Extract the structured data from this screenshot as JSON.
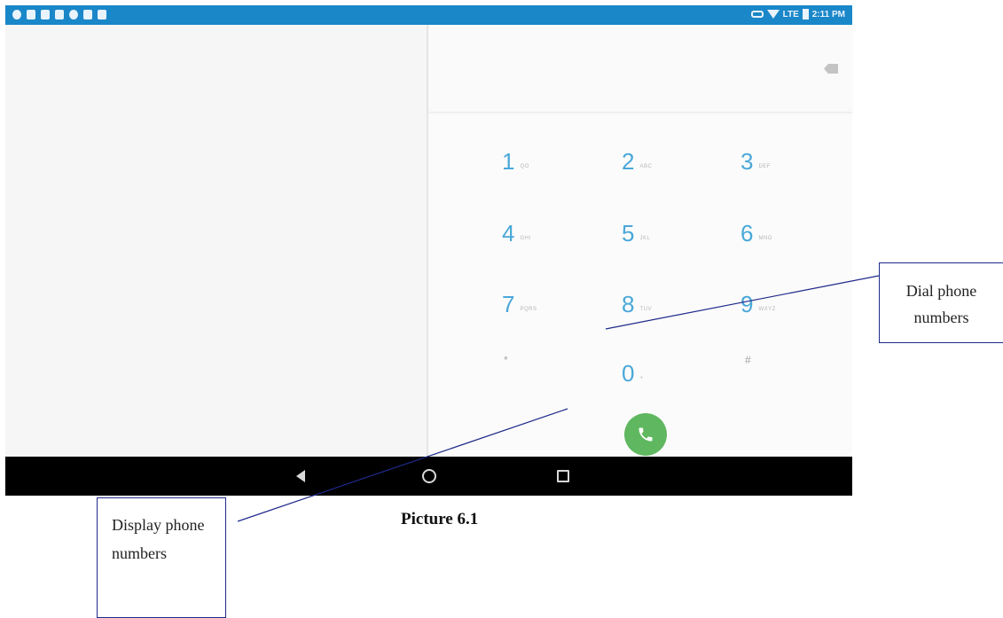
{
  "status_bar": {
    "network": "LTE",
    "time": "2:11 PM",
    "left_icons": [
      "notification-icon",
      "notification-icon",
      "notification-icon",
      "notification-icon",
      "notification-icon",
      "notification-icon",
      "notification-icon"
    ]
  },
  "dialpad": {
    "keys": [
      {
        "digit": "1",
        "letters": "QO"
      },
      {
        "digit": "2",
        "letters": "ABC"
      },
      {
        "digit": "3",
        "letters": "DEF"
      },
      {
        "digit": "4",
        "letters": "GHI"
      },
      {
        "digit": "5",
        "letters": "JKL"
      },
      {
        "digit": "6",
        "letters": "MNO"
      },
      {
        "digit": "7",
        "letters": "PQRS"
      },
      {
        "digit": "8",
        "letters": "TUV"
      },
      {
        "digit": "9",
        "letters": "WXYZ"
      },
      {
        "digit": "*",
        "letters": ""
      },
      {
        "digit": "0",
        "letters": "+"
      },
      {
        "digit": "#",
        "letters": ""
      }
    ]
  },
  "annotations": {
    "dial_label": "Dial phone numbers",
    "display_label": "Display phone numbers",
    "caption": "Picture 6.1"
  },
  "colors": {
    "status_bar": "#1a87c9",
    "digit": "#4aa8d8",
    "call_button": "#5fb760",
    "nav_bar": "#000000",
    "callout_border": "#1f2a8a"
  }
}
